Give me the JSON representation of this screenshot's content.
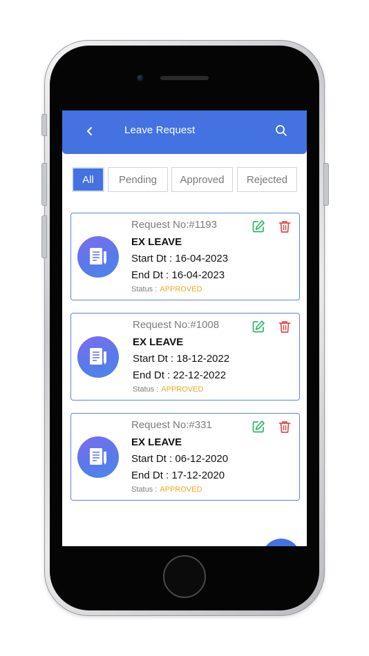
{
  "header": {
    "title": "Leave Request",
    "back_icon": "chevron-left-icon",
    "search_icon": "search-icon",
    "color": "#4472e0"
  },
  "tabs": [
    {
      "label": "All",
      "active": true
    },
    {
      "label": "Pending",
      "active": false
    },
    {
      "label": "Approved",
      "active": false
    },
    {
      "label": "Rejected",
      "active": false
    }
  ],
  "requests": [
    {
      "request_no": "Request No:#1193",
      "leave_type": "EX LEAVE",
      "start": "Start Dt : 16-04-2023",
      "end": "End Dt : 16-04-2023",
      "status_label": "Status :",
      "status": "APPROVED"
    },
    {
      "request_no": "Request No:#1008",
      "leave_type": "EX LEAVE",
      "start": "Start Dt : 18-12-2022",
      "end": "End Dt : 22-12-2022",
      "status_label": "Status :",
      "status": "APPROVED"
    },
    {
      "request_no": "Request No:#331",
      "leave_type": "EX LEAVE",
      "start": "Start Dt : 06-12-2020",
      "end": "End Dt : 17-12-2020",
      "status_label": "Status :",
      "status": "APPROVED"
    }
  ],
  "icons": {
    "card_icon": "document-pen-icon",
    "edit_icon": "edit-icon",
    "delete_icon": "trash-icon"
  },
  "colors": {
    "accent": "#4472e0",
    "approved": "#f0a824",
    "edit": "#2fb36a",
    "delete": "#e24a4a"
  }
}
